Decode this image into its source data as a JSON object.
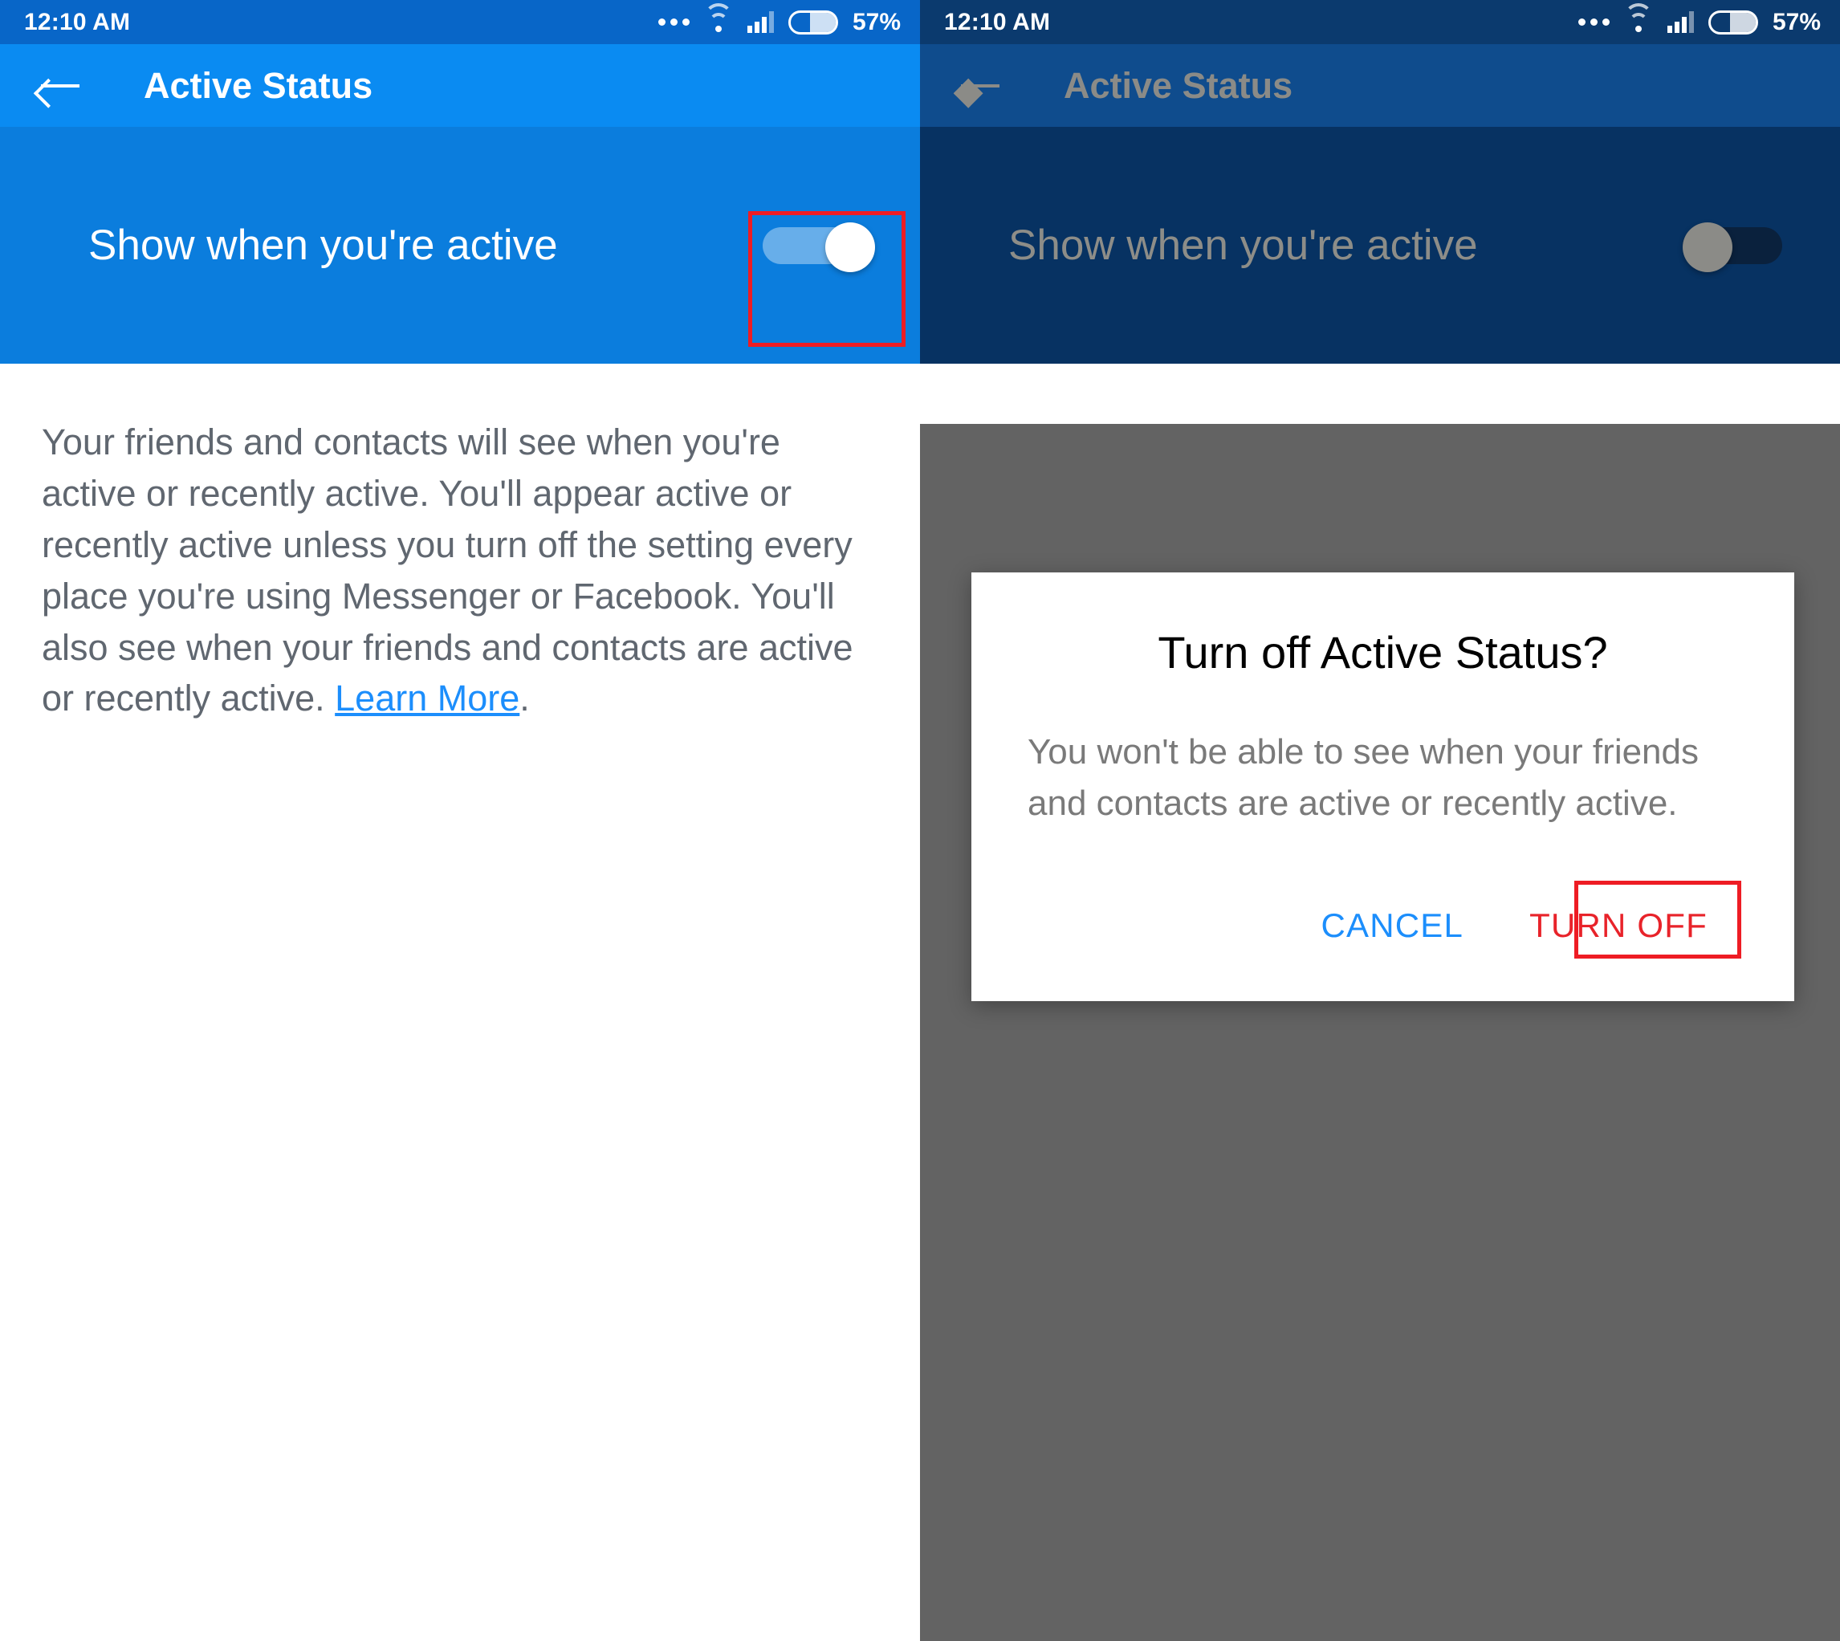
{
  "status_bar": {
    "time": "12:10 AM",
    "battery_percent": "57%",
    "icons": [
      "more-dots-icon",
      "wifi-icon",
      "cellular-signal-icon",
      "battery-icon"
    ]
  },
  "app_bar": {
    "back_icon": "back-arrow-icon",
    "title": "Active Status"
  },
  "setting": {
    "label": "Show when you're active",
    "toggle_left_state": "on",
    "toggle_right_state": "off"
  },
  "description": {
    "part1": "Your friends and contacts will see when you're active or recently active. You'll appear active or recently active unless you turn off the setting every place you're using Messenger or Facebook. You'll also see when your friends and contacts are active or recently active. ",
    "link_label": "Learn More",
    "part2": "."
  },
  "dialog": {
    "title": "Turn off Active Status?",
    "body": "You won't be able to see when your friends and contacts are active or recently active.",
    "cancel_label": "CANCEL",
    "confirm_label": "TURN OFF"
  },
  "colors": {
    "status_bar_blue": "#0866c8",
    "app_bar_blue": "#0a8bf2",
    "setting_row_blue": "#0b7ddd",
    "link_blue": "#1c8efc",
    "annotation_red": "#ee1c24",
    "destructive_red": "#e8232a",
    "scrim_gray": "#636363",
    "body_text_gray": "#606770"
  }
}
